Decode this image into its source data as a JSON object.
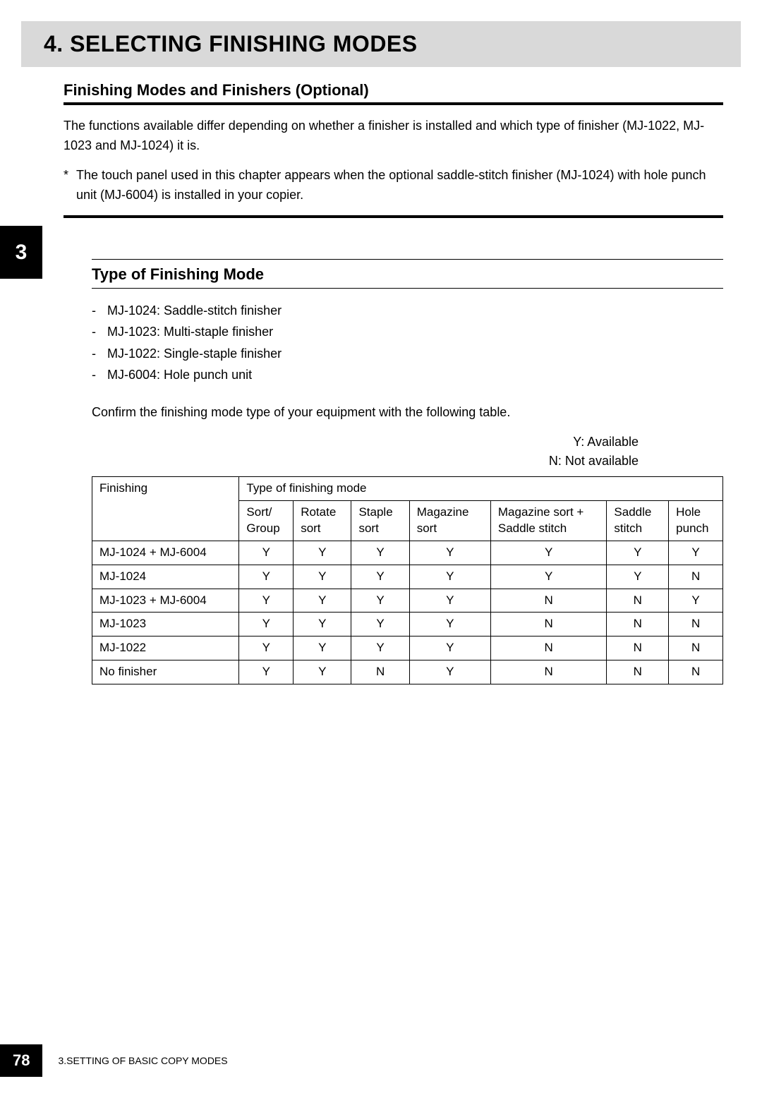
{
  "chapter_tab": "3",
  "title": "4. SELECTING FINISHING MODES",
  "subhead1": "Finishing Modes and Finishers (Optional)",
  "intro": "The functions available differ depending on whether a finisher is installed and which type of finisher (MJ-1022, MJ-1023 and MJ-1024) it is.",
  "note_star": "*",
  "note": "The touch panel used in this chapter appears when the optional saddle-stitch finisher (MJ-1024) with hole punch unit (MJ-6004) is installed in your copier.",
  "subhead2": "Type of Finishing Mode",
  "models": [
    "MJ-1024: Saddle-stitch finisher",
    "MJ-1023: Multi-staple finisher",
    "MJ-1022: Single-staple finisher",
    "MJ-6004: Hole punch unit"
  ],
  "confirm": "Confirm the finishing mode type of your equipment with the following table.",
  "legend_y": "Y: Available",
  "legend_n": "N: Not available",
  "table": {
    "col_finishing": "Finishing",
    "col_type": "Type of finishing mode",
    "head": {
      "sort_group": "Sort/ Group",
      "rotate_sort": "Rotate sort",
      "staple_sort": "Staple sort",
      "magazine_sort": "Magazine sort",
      "magazine_saddle": "Magazine sort + Saddle stitch",
      "saddle_stitch": "Saddle stitch",
      "hole_punch": "Hole punch"
    },
    "rows": [
      {
        "name": "MJ-1024 + MJ-6004",
        "v": [
          "Y",
          "Y",
          "Y",
          "Y",
          "Y",
          "Y",
          "Y"
        ]
      },
      {
        "name": "MJ-1024",
        "v": [
          "Y",
          "Y",
          "Y",
          "Y",
          "Y",
          "Y",
          "N"
        ]
      },
      {
        "name": "MJ-1023 + MJ-6004",
        "v": [
          "Y",
          "Y",
          "Y",
          "Y",
          "N",
          "N",
          "Y"
        ]
      },
      {
        "name": "MJ-1023",
        "v": [
          "Y",
          "Y",
          "Y",
          "Y",
          "N",
          "N",
          "N"
        ]
      },
      {
        "name": "MJ-1022",
        "v": [
          "Y",
          "Y",
          "Y",
          "Y",
          "N",
          "N",
          "N"
        ]
      },
      {
        "name": "No finisher",
        "v": [
          "Y",
          "Y",
          "N",
          "Y",
          "N",
          "N",
          "N"
        ]
      }
    ]
  },
  "footer": {
    "page": "78",
    "text": "3.SETTING OF BASIC COPY MODES"
  }
}
